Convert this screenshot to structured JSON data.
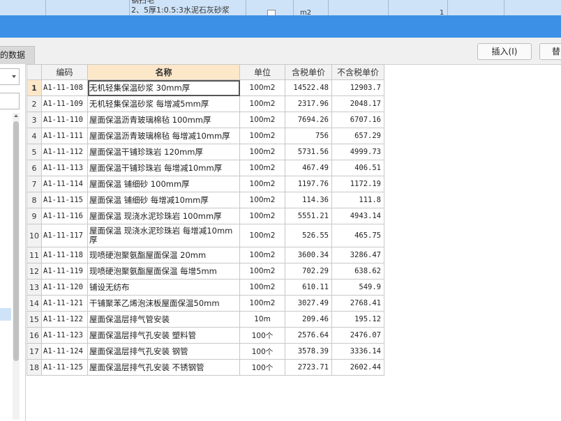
{
  "top_row": {
    "text_line1": "钢扫毛",
    "text_line2": "2、5厚1:0.5:3水泥石灰砂浆",
    "unit": "m2",
    "qty": "1"
  },
  "toolbar": {
    "tab_label": "的数据",
    "insert_label": "插入(I)",
    "replace_label": "替"
  },
  "table": {
    "headers": {
      "row_no": "",
      "code": "编码",
      "name": "名称",
      "unit": "单位",
      "price_tax": "含税单价",
      "price_notax": "不含税单价"
    },
    "rows": [
      {
        "no": "1",
        "code": "A1-11-108",
        "name": "无机轻集保温砂浆 30mm厚",
        "unit": "100m2",
        "price_tax": "14522.48",
        "price_notax": "12903.7"
      },
      {
        "no": "2",
        "code": "A1-11-109",
        "name": "无机轻集保温砂浆 每增减5mm厚",
        "unit": "100m2",
        "price_tax": "2317.96",
        "price_notax": "2048.17"
      },
      {
        "no": "3",
        "code": "A1-11-110",
        "name": "屋面保温沥青玻璃棉毡 100mm厚",
        "unit": "100m2",
        "price_tax": "7694.26",
        "price_notax": "6707.16"
      },
      {
        "no": "4",
        "code": "A1-11-111",
        "name": "屋面保温沥青玻璃棉毡 每增减10mm厚",
        "unit": "100m2",
        "price_tax": "756",
        "price_notax": "657.29"
      },
      {
        "no": "5",
        "code": "A1-11-112",
        "name": "屋面保温干铺珍珠岩 120mm厚",
        "unit": "100m2",
        "price_tax": "5731.56",
        "price_notax": "4999.73"
      },
      {
        "no": "6",
        "code": "A1-11-113",
        "name": "屋面保温干铺珍珠岩 每增减10mm厚",
        "unit": "100m2",
        "price_tax": "467.49",
        "price_notax": "406.51"
      },
      {
        "no": "7",
        "code": "A1-11-114",
        "name": "屋面保温 铺细砂 100mm厚",
        "unit": "100m2",
        "price_tax": "1197.76",
        "price_notax": "1172.19"
      },
      {
        "no": "8",
        "code": "A1-11-115",
        "name": "屋面保温 铺细砂 每增减10mm厚",
        "unit": "100m2",
        "price_tax": "114.36",
        "price_notax": "111.8"
      },
      {
        "no": "9",
        "code": "A1-11-116",
        "name": "屋面保温 现浇水泥珍珠岩 100mm厚",
        "unit": "100m2",
        "price_tax": "5551.21",
        "price_notax": "4943.14"
      },
      {
        "no": "10",
        "code": "A1-11-117",
        "name": "屋面保温 现浇水泥珍珠岩 每增减10mm厚",
        "unit": "100m2",
        "price_tax": "526.55",
        "price_notax": "465.75"
      },
      {
        "no": "11",
        "code": "A1-11-118",
        "name": "现喷硬泡聚氨酯屋面保温 20mm",
        "unit": "100m2",
        "price_tax": "3600.34",
        "price_notax": "3286.47"
      },
      {
        "no": "12",
        "code": "A1-11-119",
        "name": "现喷硬泡聚氨酯屋面保温 每增5mm",
        "unit": "100m2",
        "price_tax": "702.29",
        "price_notax": "638.62"
      },
      {
        "no": "13",
        "code": "A1-11-120",
        "name": "铺设无纺布",
        "unit": "100m2",
        "price_tax": "610.11",
        "price_notax": "549.9"
      },
      {
        "no": "14",
        "code": "A1-11-121",
        "name": "干铺聚苯乙烯泡沫板屋面保温50mm",
        "unit": "100m2",
        "price_tax": "3027.49",
        "price_notax": "2768.41"
      },
      {
        "no": "15",
        "code": "A1-11-122",
        "name": "屋面保温层排气管安装",
        "unit": "10m",
        "price_tax": "209.46",
        "price_notax": "195.12"
      },
      {
        "no": "16",
        "code": "A1-11-123",
        "name": "屋面保温层排气孔安装 塑料管",
        "unit": "100个",
        "price_tax": "2576.64",
        "price_notax": "2476.07"
      },
      {
        "no": "17",
        "code": "A1-11-124",
        "name": "屋面保温层排气孔安装 钢管",
        "unit": "100个",
        "price_tax": "3578.39",
        "price_notax": "3336.14"
      },
      {
        "no": "18",
        "code": "A1-11-125",
        "name": "屋面保温层排气孔安装 不锈钢管",
        "unit": "100个",
        "price_tax": "2723.71",
        "price_notax": "2602.44"
      }
    ]
  }
}
